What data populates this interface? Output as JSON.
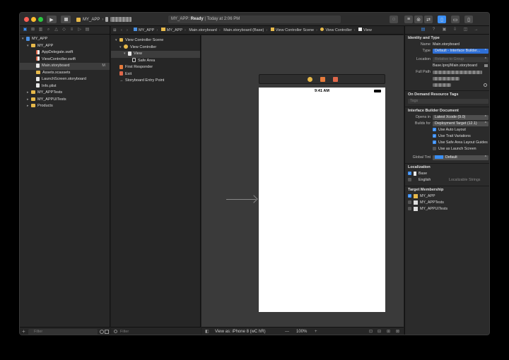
{
  "titlebar": {
    "scheme_target": "MY_APP",
    "activity_project": "MY_APP",
    "activity_status": "Ready",
    "activity_time": "Today at 2:06 PM"
  },
  "navigator": {
    "items": [
      {
        "label": "MY_APP",
        "icon": "project-icon"
      },
      {
        "label": "MY_APP",
        "icon": "folder-icon"
      },
      {
        "label": "AppDelegate.swift",
        "icon": "swift-file-icon"
      },
      {
        "label": "ViewController.swift",
        "icon": "swift-file-icon"
      },
      {
        "label": "Main.storyboard",
        "icon": "storyboard-file-icon",
        "badge": "M"
      },
      {
        "label": "Assets.xcassets",
        "icon": "folder-icon"
      },
      {
        "label": "LaunchScreen.storyboard",
        "icon": "storyboard-file-icon"
      },
      {
        "label": "Info.plist",
        "icon": "plist-file-icon"
      },
      {
        "label": "MY_APPTests",
        "icon": "folder-icon"
      },
      {
        "label": "MY_APPUITests",
        "icon": "folder-icon"
      },
      {
        "label": "Products",
        "icon": "folder-icon"
      }
    ],
    "filter_placeholder": "Filter"
  },
  "jumpbar": {
    "crumbs": [
      "MY_APP",
      "MY_APP",
      "Main.storyboard",
      "Main.storyboard (Base)",
      "View Controller Scene",
      "View Controller",
      "View"
    ]
  },
  "outline": {
    "items": [
      {
        "label": "View Controller Scene"
      },
      {
        "label": "View Controller"
      },
      {
        "label": "View"
      },
      {
        "label": "Safe Area"
      },
      {
        "label": "First Responder"
      },
      {
        "label": "Exit"
      },
      {
        "label": "Storyboard Entry Point"
      }
    ],
    "filter_placeholder": "Filter"
  },
  "canvas": {
    "status_time": "9:41 AM",
    "view_as": "View as: iPhone 8 (wC hR)",
    "zoom": "100%"
  },
  "inspector": {
    "identity_title": "Identity and Type",
    "name_label": "Name",
    "name_value": "Main.storyboard",
    "type_label": "Type",
    "type_value": "Default - Interface Builder...",
    "location_label": "Location",
    "location_value": "Relative to Group",
    "location_path": "Base.lproj/Main.storyboard",
    "fullpath_label": "Full Path",
    "odr_title": "On Demand Resource Tags",
    "tags_placeholder": "Tags",
    "ib_title": "Interface Builder Document",
    "opens_in_label": "Opens in",
    "opens_in_value": "Latest Xcode (9.0)",
    "builds_for_label": "Builds for",
    "builds_for_value": "Deployment Target (12.1)",
    "options": [
      {
        "label": "Use Auto Layout",
        "checked": true
      },
      {
        "label": "Use Trait Variations",
        "checked": true
      },
      {
        "label": "Use Safe Area Layout Guides",
        "checked": true
      },
      {
        "label": "Use as Launch Screen",
        "checked": false
      }
    ],
    "global_tint_label": "Global Tint",
    "global_tint_value": "Default",
    "localization_title": "Localization",
    "localizations": [
      {
        "label": "Base",
        "checked": true,
        "detail": ""
      },
      {
        "label": "English",
        "checked": false,
        "detail": "Localizable Strings"
      }
    ],
    "target_title": "Target Membership",
    "targets": [
      {
        "label": "MY_APP",
        "checked": true
      },
      {
        "label": "MY_APPTests",
        "checked": false
      },
      {
        "label": "MY_APPUITests",
        "checked": false
      }
    ]
  },
  "colors": {
    "accent": "#3b8ff5",
    "close": "#ff5f57",
    "minimize": "#febc2e",
    "zoom": "#28c840"
  }
}
